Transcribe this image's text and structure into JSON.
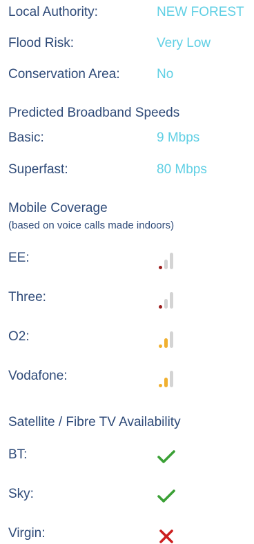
{
  "property": {
    "local_authority": {
      "label": "Local Authority:",
      "value": "NEW FOREST"
    },
    "flood_risk": {
      "label": "Flood Risk:",
      "value": "Very Low"
    },
    "conservation_area": {
      "label": "Conservation Area:",
      "value": "No"
    }
  },
  "broadband": {
    "heading": "Predicted Broadband Speeds",
    "basic": {
      "label": "Basic:",
      "value": "9 Mbps"
    },
    "superfast": {
      "label": "Superfast:",
      "value": "80 Mbps"
    }
  },
  "mobile": {
    "heading": "Mobile Coverage",
    "subheading": "(based on voice calls made indoors)",
    "networks": [
      {
        "name": "EE:",
        "signal_bars": 1,
        "signal_color": "#9b1c1c",
        "icon": "signal-strength-icon"
      },
      {
        "name": "Three:",
        "signal_bars": 1,
        "signal_color": "#9b1c1c",
        "icon": "signal-strength-icon"
      },
      {
        "name": "O2:",
        "signal_bars": 2,
        "signal_color": "#f0b030",
        "icon": "signal-strength-icon"
      },
      {
        "name": "Vodafone:",
        "signal_bars": 2,
        "signal_color": "#f0b030",
        "icon": "signal-strength-icon"
      }
    ],
    "inactive_bar_color": "#d4d4d4"
  },
  "tv": {
    "heading": "Satellite / Fibre TV Availability",
    "providers": [
      {
        "name": "BT:",
        "available": true,
        "icon": "checkmark-icon"
      },
      {
        "name": "Sky:",
        "available": true,
        "icon": "checkmark-icon"
      },
      {
        "name": "Virgin:",
        "available": false,
        "icon": "cross-icon"
      }
    ],
    "check_color": "#3aa035",
    "cross_color": "#cc1f1f"
  }
}
